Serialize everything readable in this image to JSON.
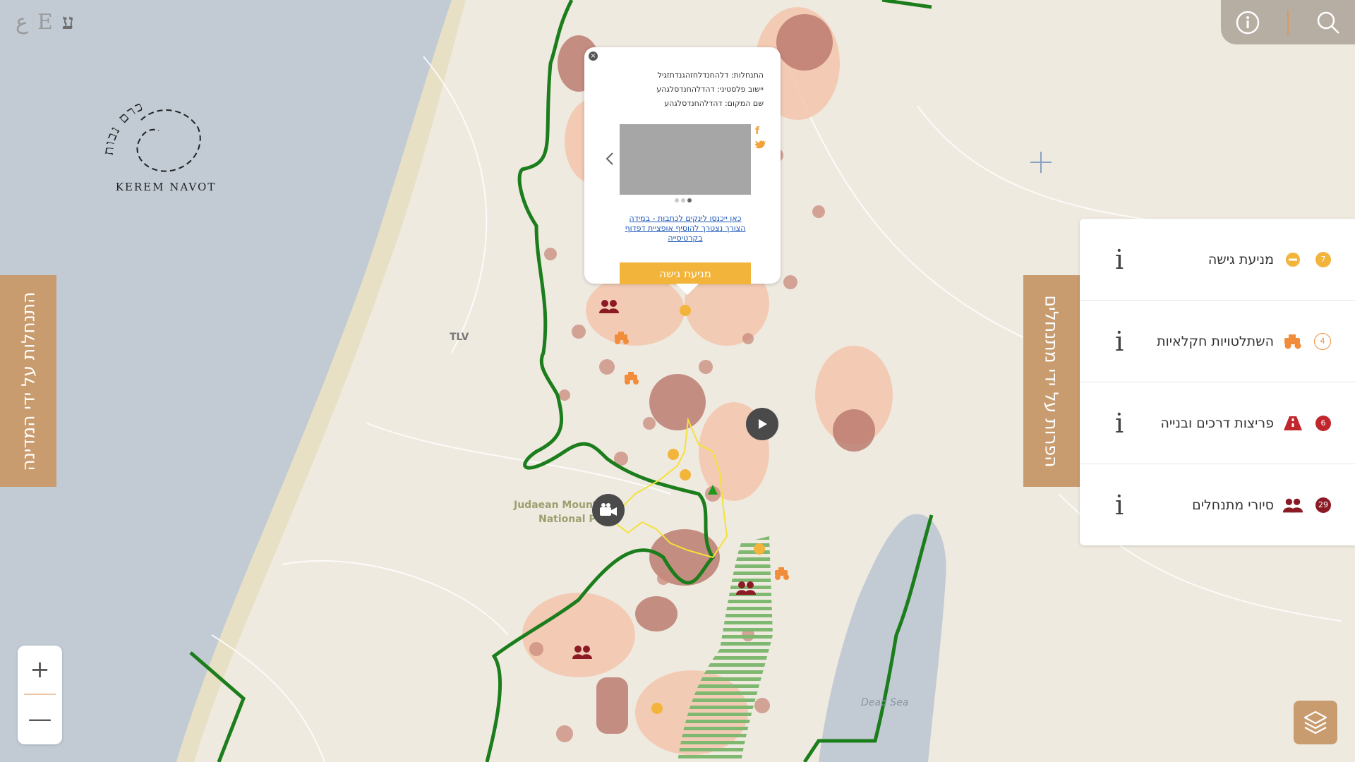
{
  "language_switcher": {
    "options": [
      "ع",
      "E",
      "ע"
    ],
    "active": "ע"
  },
  "logo": {
    "alt": "Kerem Navot logo",
    "latin_text": "KEREM NAVOT",
    "hebrew_text": "כרם נבות"
  },
  "top_right": {
    "icons": [
      "info-icon",
      "search-icon"
    ]
  },
  "left_tab": {
    "label": "התנחלות על ידי המדינה"
  },
  "right_tab": {
    "label": "הפרות על ידי מתנחלים"
  },
  "legend": {
    "items": [
      {
        "label": "מניעת גישה",
        "icon": "access-denied-icon",
        "count": "7",
        "color": "#f0a030",
        "info": "i"
      },
      {
        "label": "השתלטויות חקלאיות",
        "icon": "tractor-icon",
        "count": "4",
        "color": "#f08c3a",
        "info": "i"
      },
      {
        "label": "פריצות דרכים ובנייה",
        "icon": "road-icon",
        "count": "6",
        "color": "#c0262c",
        "info": "i"
      },
      {
        "label": "סיורי מתנחלים",
        "icon": "group-icon",
        "count": "29",
        "color": "#8b1a24",
        "info": "i"
      }
    ]
  },
  "zoom": {
    "plus": "+",
    "minus": "—"
  },
  "popup": {
    "close": "×",
    "line1": "התנחלות: דלהחנדלחזהגנדתזגיל",
    "line2": "יישוב פלסטיני: דהדלהחנדסלגהע",
    "line3": "שם המקום: דהדלהחנדסלגהע",
    "link_text": "כאן ייכנסו לינקים לכתבות - במידה הצורך נצטרך להוסיף אופציית דפדוף בקרטיסייה",
    "action_label": "מניעת גישה",
    "social": [
      "facebook-icon",
      "twitter-icon"
    ],
    "gallery_dots": 3,
    "gallery_active": 2
  },
  "map_labels": {
    "city": "TLV",
    "park_line1": "Judaean Mounta",
    "park_line2": "National Park",
    "sea": "Dead Sea"
  },
  "colors": {
    "accent": "#c99c6f",
    "green_line": "#1b7d1b",
    "yellow_line": "#f3e13a",
    "zone_dark": "#b9766a",
    "zone_light": "#f3c6ad",
    "water": "#c2cbd4"
  }
}
